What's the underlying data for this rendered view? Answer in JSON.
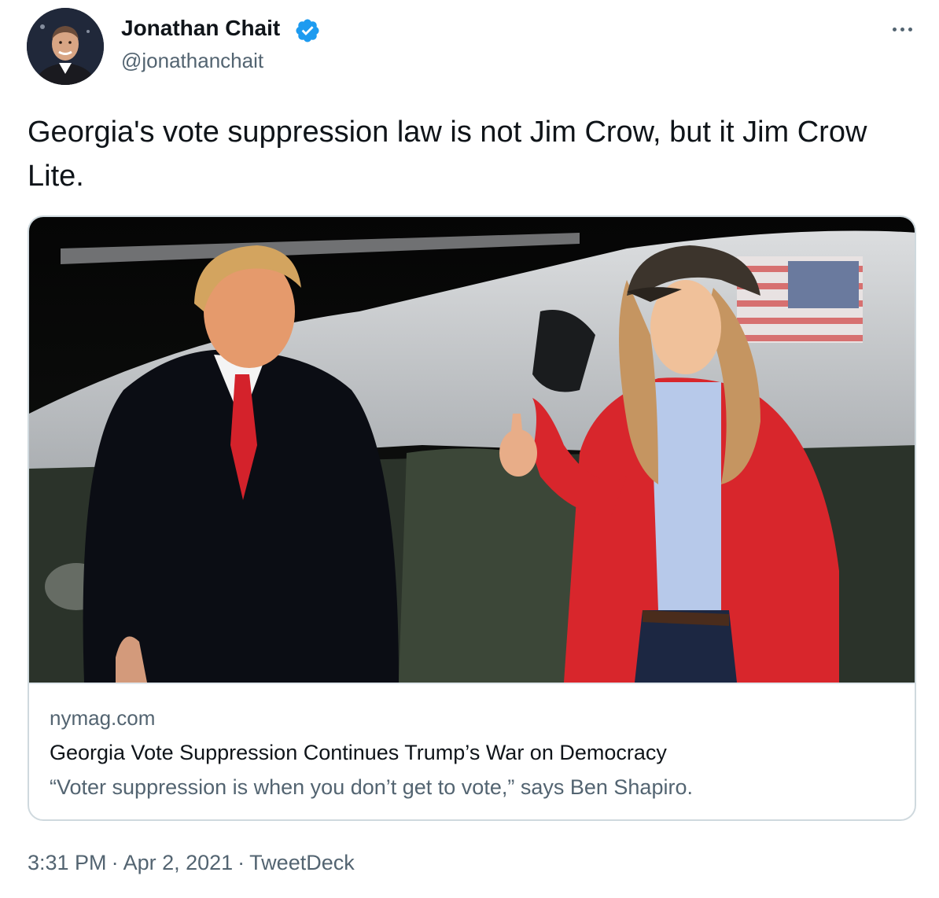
{
  "author": {
    "name": "Jonathan Chait",
    "handle": "@jonathanchait",
    "verified": true,
    "avatar_icon": "profile-photo"
  },
  "tweet": {
    "text": "Georgia's vote suppression law is not Jim Crow, but it Jim Crow Lite."
  },
  "link_card": {
    "domain": "nymag.com",
    "title": "Georgia Vote Suppression Continues Trump’s War on Democracy",
    "description": "“Voter suppression is when you don’t get to vote,” says Ben Shapiro."
  },
  "meta": {
    "time": "3:31 PM",
    "date": "Apr 2, 2021",
    "client": "TweetDeck",
    "separator": "·"
  },
  "colors": {
    "text": "#0f1419",
    "secondary": "#536471",
    "verified": "#1d9bf0",
    "border": "#cfd9de"
  },
  "icons": {
    "verified": "verified-badge-icon",
    "more": "more-horizontal-icon"
  }
}
